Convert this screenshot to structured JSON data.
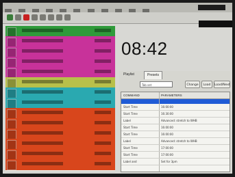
{
  "clock": {
    "time": "08:42"
  },
  "colors": {
    "rundown_rows": [
      "#2f9a3a",
      "#c8329a",
      "#c8329a",
      "#c8329a",
      "#c8329a",
      "#b8c04a",
      "#2aa9b0",
      "#2aa9b0",
      "#d8461c",
      "#d8461c",
      "#d8461c",
      "#d8461c",
      "#d8461c",
      "#d8461c"
    ],
    "selection": "#1f5bd6"
  },
  "panel": {
    "tabs": [
      {
        "label": "Playlist"
      },
      {
        "label": "Presets"
      }
    ],
    "search": {
      "value": "Tab set"
    },
    "buttons": [
      {
        "label": "Change"
      },
      {
        "label": "Load"
      },
      {
        "label": "Load/Next"
      }
    ],
    "table": {
      "headers": [
        "COMMAND",
        "PARAMETERS"
      ],
      "rows": [
        {
          "cmd": "Start Time",
          "param": "16:00:00"
        },
        {
          "cmd": "Start Time",
          "param": "16:30:00"
        },
        {
          "cmd": "Label",
          "param": "Advanced: stretch to WHB"
        },
        {
          "cmd": "Start Time",
          "param": "16:00:00"
        },
        {
          "cmd": "Start Time",
          "param": "16:00:00"
        },
        {
          "cmd": "Label",
          "param": "Advanced: stretch to WHB"
        },
        {
          "cmd": "Start Time",
          "param": "17:00:00"
        },
        {
          "cmd": "Start Time",
          "param": "17:00:00"
        },
        {
          "cmd": "Label and",
          "param": "Set for 3pm"
        }
      ]
    }
  }
}
